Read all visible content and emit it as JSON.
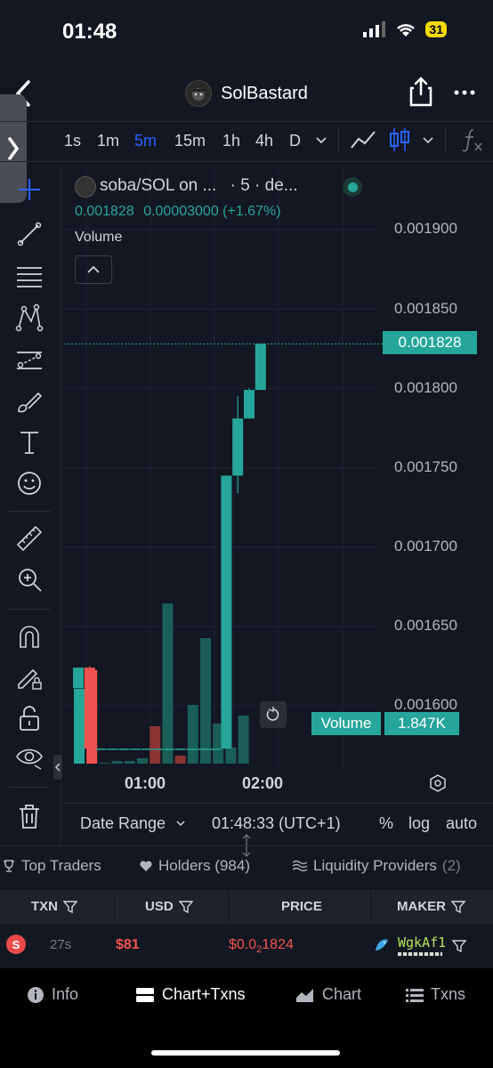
{
  "status_bar": {
    "time": "01:48",
    "battery": "31"
  },
  "header": {
    "title": "SolBastard"
  },
  "toolbar": {
    "timeframes": [
      "1s",
      "1m",
      "5m",
      "15m",
      "1h",
      "4h",
      "D"
    ],
    "active_timeframe": "5m"
  },
  "chart_info": {
    "pair": "soba/SOL on ...",
    "interval_source": "· 5 · de...",
    "last_price": "0.001828",
    "change": "0.00003000 (+1.67%)",
    "volume_label": "Volume",
    "volume_value": "1.847K"
  },
  "chart_data": {
    "type": "candlestick",
    "price_axis_ticks": [
      "0.001900",
      "0.001850",
      "0.001800",
      "0.001750",
      "0.001700",
      "0.001650",
      "0.001600"
    ],
    "time_axis_ticks": [
      "01:00",
      "02:00"
    ],
    "last_price_tag": "0.001828",
    "candles": [
      {
        "open": 0.001611,
        "high": 0.001624,
        "low": 0.001611,
        "close": 0.001624,
        "dir": "up"
      },
      {
        "open": 0.001624,
        "high": 0.001625,
        "low": 0.001573,
        "close": 0.001573,
        "dir": "down"
      },
      {
        "open": 0.001573,
        "high": 0.001573,
        "low": 0.001573,
        "close": 0.001573,
        "dir": "flat"
      },
      {
        "open": 0.001573,
        "high": 0.001573,
        "low": 0.001573,
        "close": 0.001573,
        "dir": "flat"
      },
      {
        "open": 0.001573,
        "high": 0.001573,
        "low": 0.001573,
        "close": 0.001573,
        "dir": "flat"
      },
      {
        "open": 0.001573,
        "high": 0.001573,
        "low": 0.001573,
        "close": 0.001573,
        "dir": "flat"
      },
      {
        "open": 0.001573,
        "high": 0.001573,
        "low": 0.001573,
        "close": 0.001573,
        "dir": "flat"
      },
      {
        "open": 0.001573,
        "high": 0.001573,
        "low": 0.001573,
        "close": 0.001573,
        "dir": "flat"
      },
      {
        "open": 0.001573,
        "high": 0.001573,
        "low": 0.001573,
        "close": 0.001573,
        "dir": "flat"
      },
      {
        "open": 0.001573,
        "high": 0.001573,
        "low": 0.001573,
        "close": 0.001573,
        "dir": "flat"
      },
      {
        "open": 0.001573,
        "high": 0.001573,
        "low": 0.001573,
        "close": 0.001573,
        "dir": "flat"
      },
      {
        "open": 0.001573,
        "high": 0.001573,
        "low": 0.001573,
        "close": 0.001573,
        "dir": "flat"
      },
      {
        "open": 0.001573,
        "high": 0.001573,
        "low": 0.001573,
        "close": 0.001573,
        "dir": "flat"
      },
      {
        "open": 0.001573,
        "high": 0.001745,
        "low": 0.001573,
        "close": 0.001745,
        "dir": "up"
      },
      {
        "open": 0.001745,
        "high": 0.001795,
        "low": 0.001734,
        "close": 0.001781,
        "dir": "up"
      },
      {
        "open": 0.001781,
        "high": 0.0018,
        "low": 0.001781,
        "close": 0.001799,
        "dir": "up"
      },
      {
        "open": 0.001799,
        "high": 0.001828,
        "low": 0.001799,
        "close": 0.001828,
        "dir": "up"
      }
    ],
    "volume_bars": [
      {
        "value": 0.28,
        "dir": "up"
      },
      {
        "value": 0.35,
        "dir": "down"
      },
      {
        "value": 0.0,
        "dir": "flat"
      },
      {
        "value": 0.01,
        "dir": "up"
      },
      {
        "value": 0.01,
        "dir": "up"
      },
      {
        "value": 0.02,
        "dir": "up"
      },
      {
        "value": 0.14,
        "dir": "down"
      },
      {
        "value": 0.6,
        "dir": "up"
      },
      {
        "value": 0.03,
        "dir": "down"
      },
      {
        "value": 0.22,
        "dir": "up"
      },
      {
        "value": 0.47,
        "dir": "up"
      },
      {
        "value": 0.15,
        "dir": "up"
      },
      {
        "value": 0.06,
        "dir": "up"
      },
      {
        "value": 0.18,
        "dir": "up"
      }
    ]
  },
  "chart_footer": {
    "date_range": "Date Range",
    "clock": "01:48:33 (UTC+1)",
    "percent": "%",
    "log": "log",
    "auto": "auto"
  },
  "tabs": {
    "top_traders": "Top Traders",
    "holders": "Holders (984)",
    "liquidity": "Liquidity Providers",
    "liquidity_count": "(2)"
  },
  "table": {
    "headers": [
      "TXN",
      "USD",
      "PRICE",
      "MAKER"
    ],
    "row": {
      "type": "S",
      "age": "27s",
      "usd": "$81",
      "price_prefix": "$0.0",
      "price_sub": "2",
      "price_suffix": "1824",
      "maker": "WgkAf1"
    }
  },
  "bottom_nav": {
    "info": "Info",
    "chart_txns": "Chart+Txns",
    "chart": "Chart",
    "txns": "Txns"
  },
  "colors": {
    "up": "#26a69a",
    "down": "#ef5350",
    "accent": "#2962ff"
  }
}
